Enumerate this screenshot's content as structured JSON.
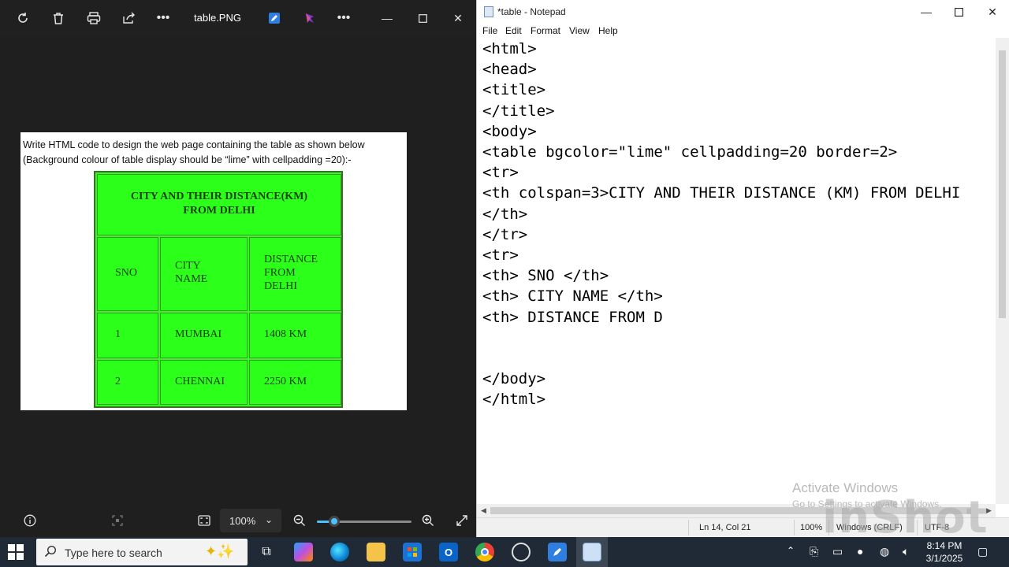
{
  "viewer": {
    "filename": "table.PNG",
    "toolbar_icons": [
      "rotate-icon",
      "delete-icon",
      "print-icon",
      "share-icon",
      "more-icon",
      "edit-icon",
      "designer-icon",
      "more-icon"
    ],
    "zoom_label": "100%",
    "zoom_level_percent": 18,
    "document": {
      "line1": "Write HTML code to design the web page containing the table as shown below",
      "line2": "(Background colour of table display should be “lime” with cellpadding =20):-",
      "table": {
        "title": "CITY AND THEIR DISTANCE(KM)",
        "title2": "FROM DELHI",
        "headers": {
          "sno": "SNO",
          "city": [
            "CITY",
            "NAME"
          ],
          "distance": [
            "DISTANCE",
            "FROM",
            "DELHI"
          ]
        },
        "rows": [
          {
            "sno": "1",
            "city": "MUMBAI",
            "distance": "1408 KM"
          },
          {
            "sno": "2",
            "city": "CHENNAI",
            "distance": "2250 KM"
          }
        ],
        "background": "#2bff1a"
      }
    }
  },
  "notepad": {
    "title": "*table - Notepad",
    "menu": [
      "File",
      "Edit",
      "Format",
      "View",
      "Help"
    ],
    "code_lines": [
      "<html>",
      "<head>",
      "<title>",
      "</title>",
      "<body>",
      "<table bgcolor=\"lime\" cellpadding=20 border=2>",
      "<tr>",
      "<th colspan=3>CITY AND THEIR DISTANCE (KM) FROM DELHI",
      "</th>",
      "</tr>",
      "<tr>",
      "<th> SNO </th>",
      "<th> CITY NAME </th>",
      "<th> DISTANCE FROM D",
      "",
      "",
      "</body>",
      "</html>"
    ],
    "status": {
      "position": "Ln 14, Col 21",
      "zoom": "100%",
      "line_ending": "Windows (CRLF)",
      "encoding": "UTF-8"
    }
  },
  "watermark": {
    "activate_title": "Activate Windows",
    "activate_sub": "Go to Settings to activate Windows.",
    "inshot": "inShot"
  },
  "taskbar": {
    "search_placeholder": "Type here to search",
    "time": "8:14 PM",
    "date": "3/1/2025"
  }
}
